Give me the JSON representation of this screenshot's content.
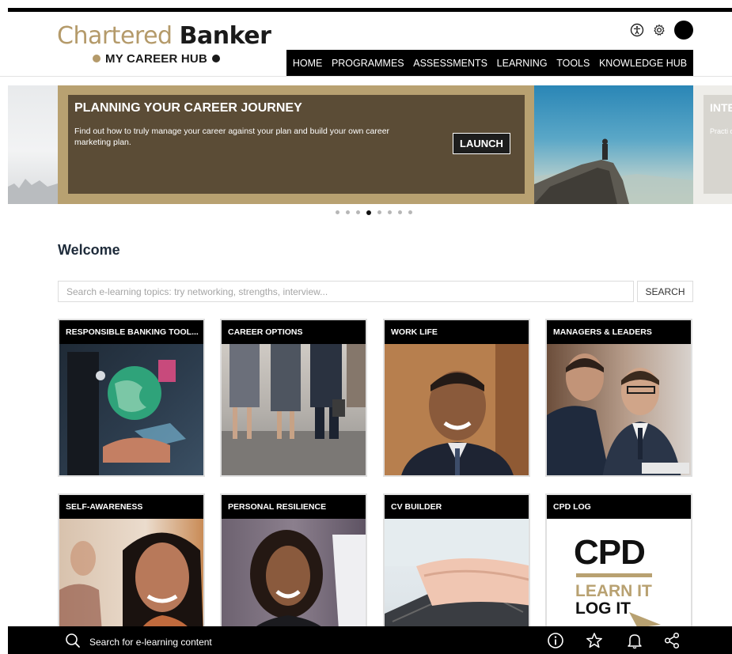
{
  "brand": {
    "name_part1": "Chartered",
    "name_part2": "Banker",
    "subtitle": "MY CAREER HUB",
    "gold": "#b49a6a",
    "dark": "#1a1a1a"
  },
  "header": {
    "icons": [
      "accessibility-icon",
      "settings-icon",
      "avatar"
    ]
  },
  "nav": {
    "items": [
      "HOME",
      "PROGRAMMES",
      "ASSESSMENTS",
      "LEARNING",
      "TOOLS",
      "KNOWLEDGE HUB"
    ]
  },
  "hero": {
    "title": "PLANNING YOUR CAREER JOURNEY",
    "description": "Find out how to truly manage your career against your plan and build your own career marketing plan.",
    "button": "LAUNCH",
    "next_title": "INTE",
    "next_desc": "Practi quest"
  },
  "carousel": {
    "dots": 8,
    "active_index": 3
  },
  "welcome": {
    "title": "Welcome"
  },
  "search": {
    "placeholder": "Search e-learning topics: try networking, strengths, interview...",
    "button": "SEARCH"
  },
  "cards": [
    {
      "title": "RESPONSIBLE BANKING TOOL..."
    },
    {
      "title": "CAREER OPTIONS"
    },
    {
      "title": "WORK LIFE"
    },
    {
      "title": "MANAGERS & LEADERS"
    },
    {
      "title": "SELF-AWARENESS"
    },
    {
      "title": "PERSONAL RESILIENCE"
    },
    {
      "title": "CV BUILDER"
    },
    {
      "title": "CPD LOG",
      "image_text": [
        "CPD",
        "LEARN IT",
        "LOG IT"
      ]
    }
  ],
  "bottom_bar": {
    "search_label": "Search for e-learning content",
    "icons": [
      "info-icon",
      "star-icon",
      "bell-icon",
      "share-icon"
    ]
  }
}
